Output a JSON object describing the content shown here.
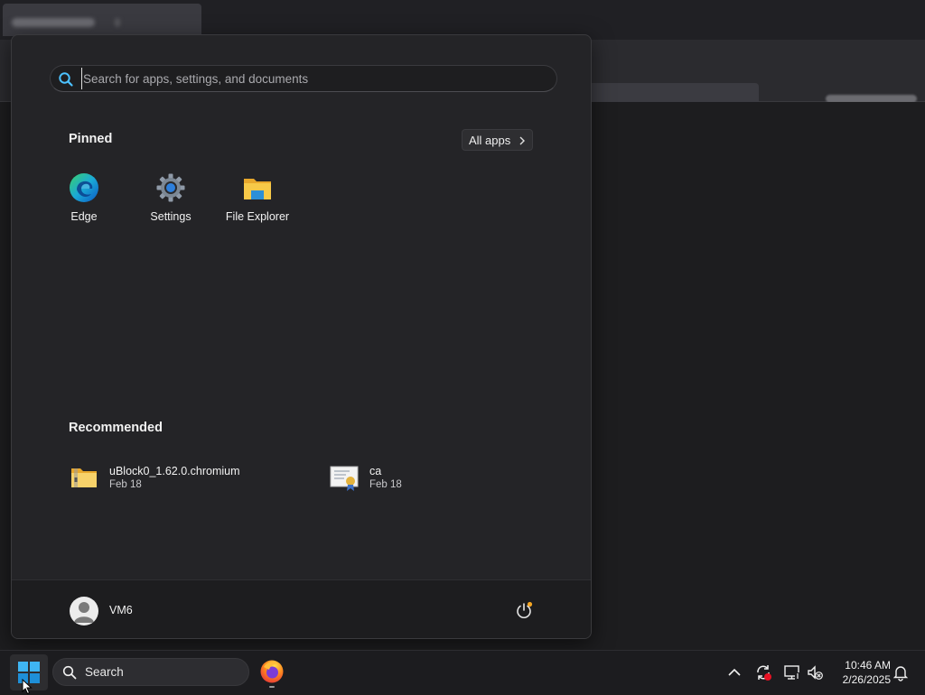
{
  "start_menu": {
    "search": {
      "placeholder": "Search for apps, settings, and documents",
      "value": ""
    },
    "pinned": {
      "title": "Pinned",
      "all_apps_label": "All apps",
      "items": [
        {
          "label": "Edge",
          "icon": "edge-icon"
        },
        {
          "label": "Settings",
          "icon": "settings-gear-icon"
        },
        {
          "label": "File Explorer",
          "icon": "file-explorer-icon"
        }
      ]
    },
    "recommended": {
      "title": "Recommended",
      "items": [
        {
          "name": "uBlock0_1.62.0.chromium",
          "date": "Feb 18",
          "icon": "zip-folder-icon"
        },
        {
          "name": "ca",
          "date": "Feb 18",
          "icon": "certificate-icon"
        }
      ]
    },
    "user": {
      "name": "VM6",
      "avatar_icon": "user-avatar-icon"
    },
    "power_icon": "power-icon"
  },
  "taskbar": {
    "start_icon": "windows-logo-icon",
    "search_label": "Search",
    "apps": [
      {
        "icon": "firefox-icon",
        "running": true
      }
    ],
    "tray_icons": [
      "chevron-up-icon",
      "sync-alert-icon",
      "network-icon",
      "speaker-muted-icon",
      "notification-bell-icon"
    ],
    "time": "10:46 AM",
    "date": "2/26/2025"
  },
  "colors": {
    "menu_background": "#242427",
    "footer_background": "#1d1d1f",
    "taskbar_background": "#1c1c1f",
    "accent_blue": "#0a84d6",
    "folder_yellow": "#f7c948"
  }
}
